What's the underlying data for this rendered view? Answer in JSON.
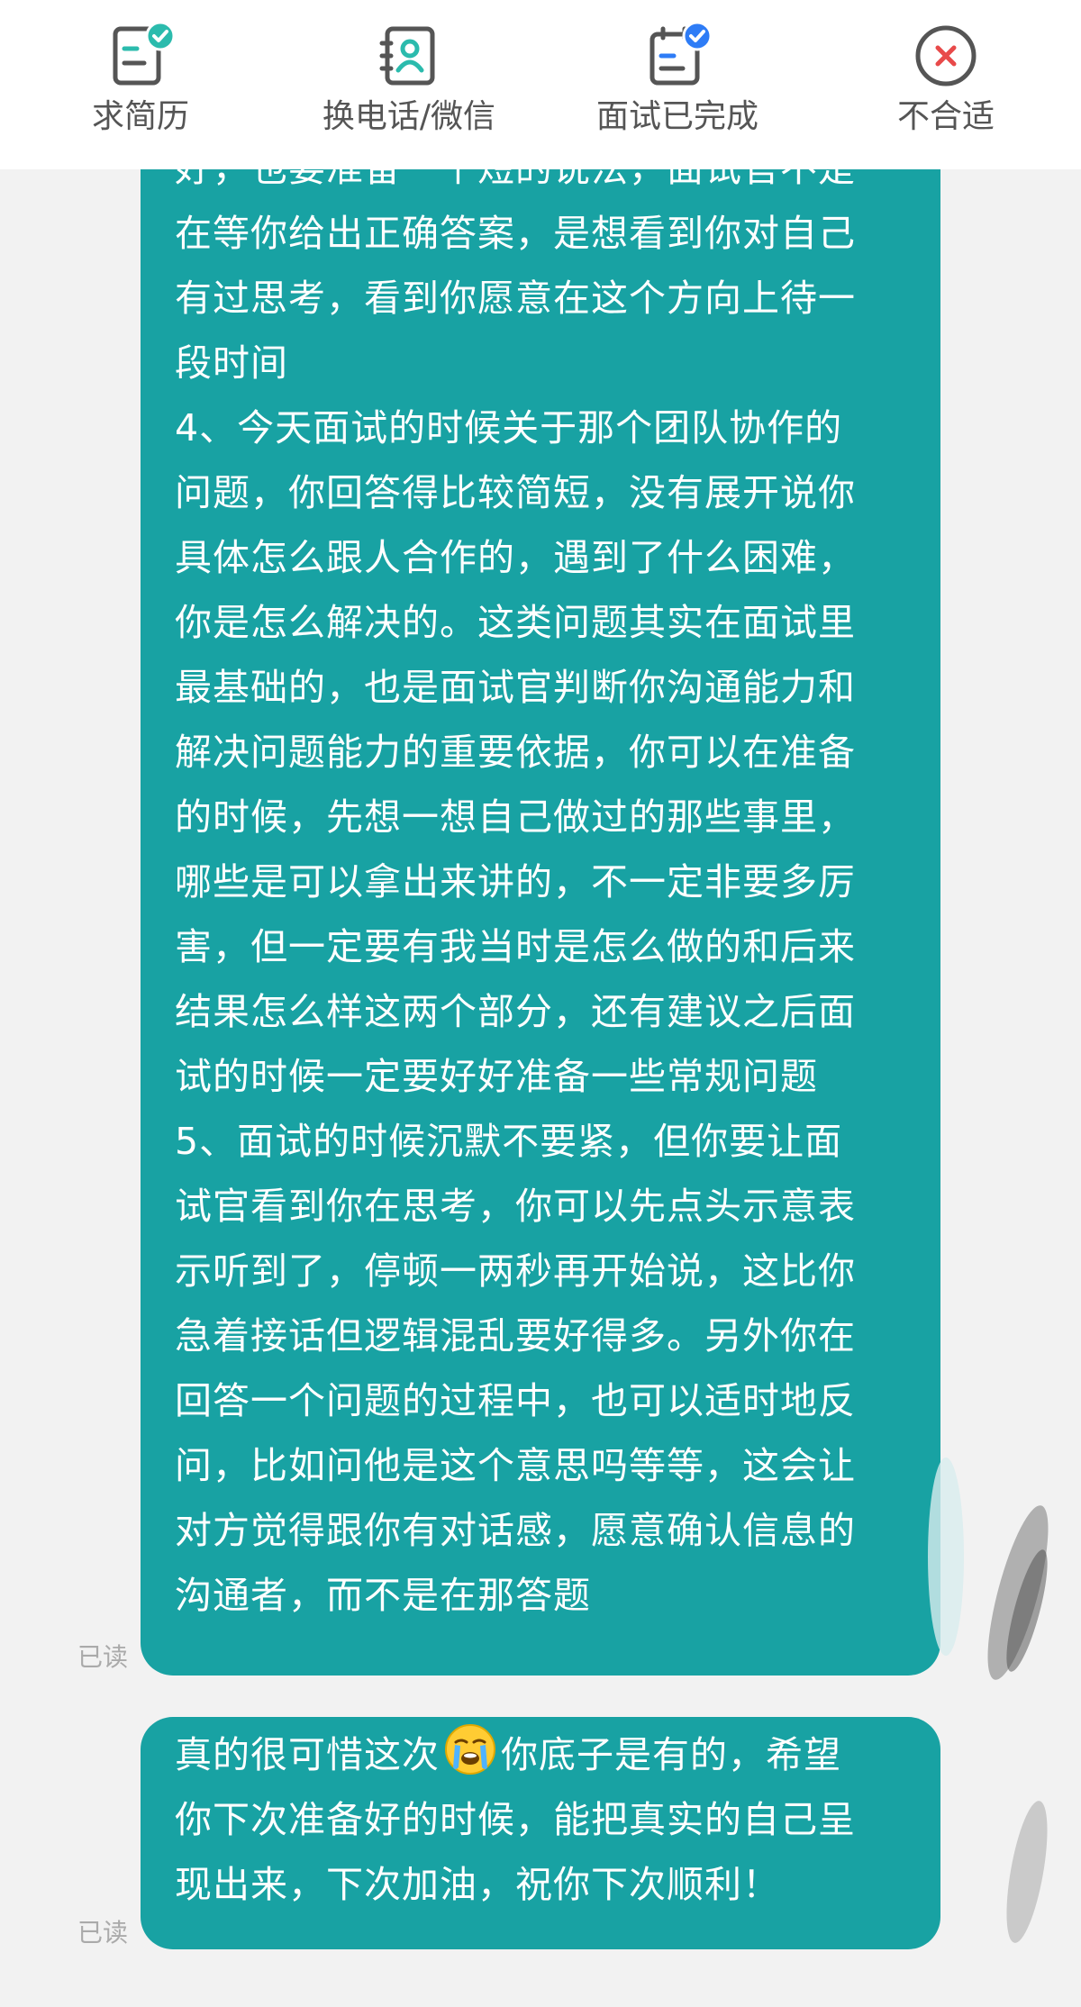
{
  "actions": [
    {
      "label": "求简历",
      "icon": "resume-request-icon"
    },
    {
      "label": "换电话/微信",
      "icon": "exchange-contact-icon"
    },
    {
      "label": "面试已完成",
      "icon": "interview-done-icon"
    },
    {
      "label": "不合适",
      "icon": "reject-icon"
    }
  ],
  "colors": {
    "accent_teal": "#18a2a3",
    "icon_green": "#2bbbad",
    "icon_blue": "#2e7cf6",
    "reject_red": "#e84a4a"
  },
  "messages": [
    {
      "lines": [
        "好，也要准备一个短的说法，面试官不是",
        "在等你给出正确答案，是想看到你对自己",
        "有过思考，看到你愿意在这个方向上待一",
        "段时间",
        "4、今天面试的时候关于那个团队协作的",
        "问题，你回答得比较简短，没有展开说你",
        "具体怎么跟人合作的，遇到了什么困难，",
        "你是怎么解决的。这类问题其实在面试里",
        "最基础的，也是面试官判断你沟通能力和",
        "解决问题能力的重要依据，你可以在准备",
        "的时候，先想一想自己做过的那些事里，",
        "哪些是可以拿出来讲的，不一定非要多厉",
        "害，但一定要有我当时是怎么做的和后来",
        "结果怎么样这两个部分，还有建议之后面",
        "试的时候一定要好好准备一些常规问题",
        "5、面试的时候沉默不要紧，但你要让面",
        "试官看到你在思考，你可以先点头示意表",
        "示听到了，停顿一两秒再开始说，这比你",
        "急着接话但逻辑混乱要好得多。另外你在",
        "回答一个问题的过程中，也可以适时地反",
        "问，比如问他是这个意思吗等等，这会让",
        "对方觉得跟你有对话感，愿意确认信息的",
        "沟通者，而不是在那答题"
      ],
      "status": "已读"
    },
    {
      "line1_before": "真的很可惜这次",
      "emoji": "loudly-crying-face-emoji",
      "line1_after": "你底子是有的，希望",
      "lines_rest": [
        "你下次准备好的时候，能把真实的自己呈",
        "现出来，下次加油，祝你下次顺利！"
      ],
      "status": "已读"
    }
  ]
}
